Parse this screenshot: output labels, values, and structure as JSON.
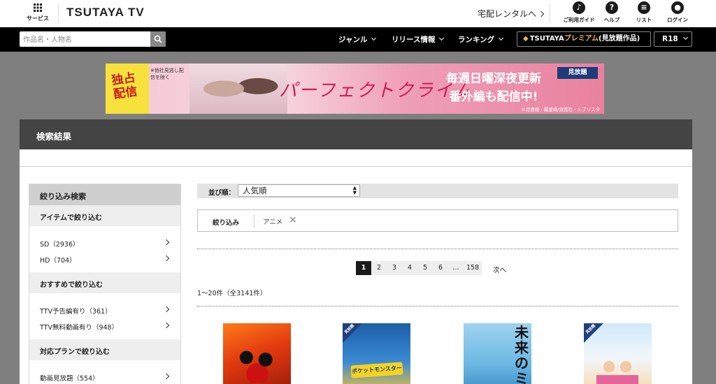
{
  "header": {
    "service_label": "サービス",
    "logo": "TSUTAYA TV",
    "rental_link": "宅配レンタルへ",
    "icons": [
      {
        "label": "ご利用ガイド",
        "glyph": "♪"
      },
      {
        "label": "ヘルプ",
        "glyph": "?"
      },
      {
        "label": "リスト",
        "glyph": "≡"
      },
      {
        "label": "ログイン",
        "glyph": "●"
      }
    ]
  },
  "nav": {
    "search_placeholder": "作品名・人物名",
    "items": [
      "ジャンル",
      "リリース情報",
      "ランキング"
    ],
    "premium": {
      "brand": "TSUTAYA",
      "name": "プレミアム",
      "suffix": "(見放題作品)"
    },
    "r18": "R18"
  },
  "banner": {
    "exclusive": "独占配信",
    "note": "※他社見逃し配信を除く",
    "title": "パーフェクトクライム",
    "promo_line1": "毎週日曜深夜更新",
    "promo_line2": "番外編も配信中!",
    "badge": "見放題",
    "copyright": "©月島綾・鳳里崎/双葉社・エブリスタ"
  },
  "results": {
    "title": "検索結果",
    "sort_label": "並び順：",
    "sort_value": "人気順",
    "filter_label": "絞り込み",
    "filter_chip": "アニメ",
    "count_text": "1〜20件（全3141件）",
    "pages": [
      "1",
      "2",
      "3",
      "4",
      "5",
      "6",
      "...",
      "158"
    ],
    "next": "次へ"
  },
  "sidebar": {
    "title": "絞り込み検索",
    "sections": [
      {
        "header": "アイテムで絞り込む",
        "items": [
          "SD（2936）",
          "HD（704）"
        ]
      },
      {
        "header": "おすすめで絞り込む",
        "items": [
          "TTV予告編有り（361）",
          "TTV無料動画有り（948）"
        ]
      },
      {
        "header": "対応プランで絞り込む",
        "items": [
          "動画見放題（554）"
        ]
      }
    ]
  },
  "posters": {
    "badge": "見放題",
    "poster2_logo": "ポケットモンスター",
    "poster3_title": "未来のミ"
  },
  "colors": {
    "topbar_bg": "#ffffff",
    "navbar_bg": "#000000",
    "page_bg": "#7f7f7f",
    "panel_head_bg": "#444444",
    "premium_accent": "#e8b84a"
  }
}
